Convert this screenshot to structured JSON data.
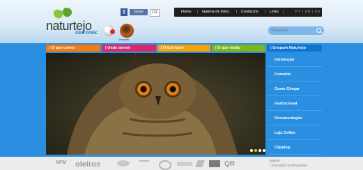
{
  "header": {
    "brand": "naturtejo",
    "brand_sub": "GEO.PARK",
    "badge_text": "Geopark",
    "facebook": {
      "like_label": "Gosto",
      "count": "131"
    },
    "topnav": [
      "Home",
      "Galeria de fotos",
      "Contactos",
      "Links"
    ],
    "languages": [
      "PT",
      "EN",
      "ES"
    ],
    "search": {
      "placeholder": "Pesquisa"
    }
  },
  "menu": [
    {
      "label": "| O que comer",
      "color": "#f27a10"
    },
    {
      "label": "| Onde dormir",
      "color": "#d42a6e"
    },
    {
      "label": "| O que fazer",
      "color": "#f4a20b"
    },
    {
      "label": "| O que visitar",
      "color": "#7cb61b"
    }
  ],
  "geopark_menu": {
    "heading": "| Geopark Naturtejo",
    "items": [
      "Introdução",
      "Conceito",
      "Como Chegar",
      "Institucional",
      "Documentação",
      "Loja Online",
      "Clipping"
    ]
  },
  "slider": {
    "dot_colors": [
      "#ffffff",
      "#f2c300",
      "#ffffff",
      "#ffffff"
    ]
  },
  "footer": {
    "partners": [
      "NFM",
      "oleiros",
      "",
      "",
      "",
      "",
      "",
      "",
      "QR"
    ],
    "newsletter_heading": "AVISOS",
    "newsletter_link": "| Inscrição na Newsletter"
  },
  "colors": {
    "accent_blue": "#2a8fe0",
    "dark_nav": "#1e1e1e"
  }
}
